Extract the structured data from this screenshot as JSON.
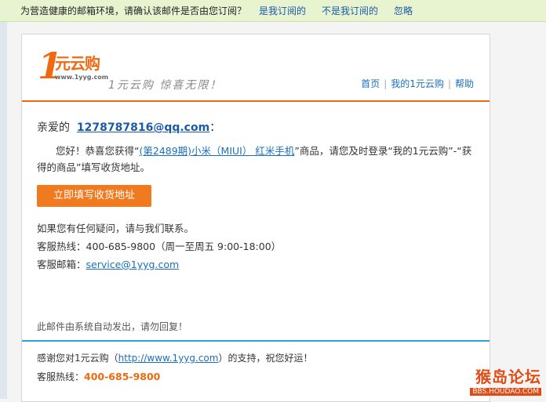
{
  "notice": {
    "text": "为营造健康的邮箱环境，请确认该邮件是否由您订阅？",
    "actions": [
      "是我订阅的",
      "不是我订阅的",
      "忽略"
    ]
  },
  "brand": {
    "logo_numeral": "1",
    "logo_text": "元云购",
    "logo_url": "www.1yyg.com",
    "slogan": "1元云购 惊喜无限！"
  },
  "nav": {
    "items": [
      "首页",
      "我的1元云购",
      "帮助"
    ],
    "separator": "|"
  },
  "greeting": {
    "prefix": "亲爱的",
    "email": "1278787816@qq.com",
    "suffix": "："
  },
  "message": {
    "before": "您好！恭喜您获得“",
    "product": "(第2489期)小米（MIUI） 红米手机",
    "after": "”商品，请您及时登录“我的1元云购”-“获得的商品”填写收货地址。"
  },
  "cta": {
    "label": "立即填写收货地址"
  },
  "contact": {
    "question": "如果您有任何疑问，请与我们联系。",
    "hotline_label": "客服热线：",
    "hotline_value": "400-685-9800（周一至周五 9:00-18:00）",
    "email_label": "客服邮箱：",
    "email_value": "service@1yyg.com"
  },
  "auto_note": "此邮件由系统自动发出，请勿回复！",
  "footer": {
    "thanks_before": "感谢您对1元云购（",
    "thanks_link": "http://www.1yyg.com",
    "thanks_after": "）的支持，祝您好运！",
    "hotline_label": "客服热线：",
    "hotline_value": "400-685-9800"
  },
  "watermark": {
    "title": "猴岛论坛",
    "url": "BBS.HOUDAO.COM"
  },
  "colors": {
    "brand_orange": "#ee6a10",
    "cta": "#ef7a1f",
    "link": "#1a6fbf",
    "divider_blue": "#2d9ee0",
    "notice_bg": "#e8f4d0"
  }
}
